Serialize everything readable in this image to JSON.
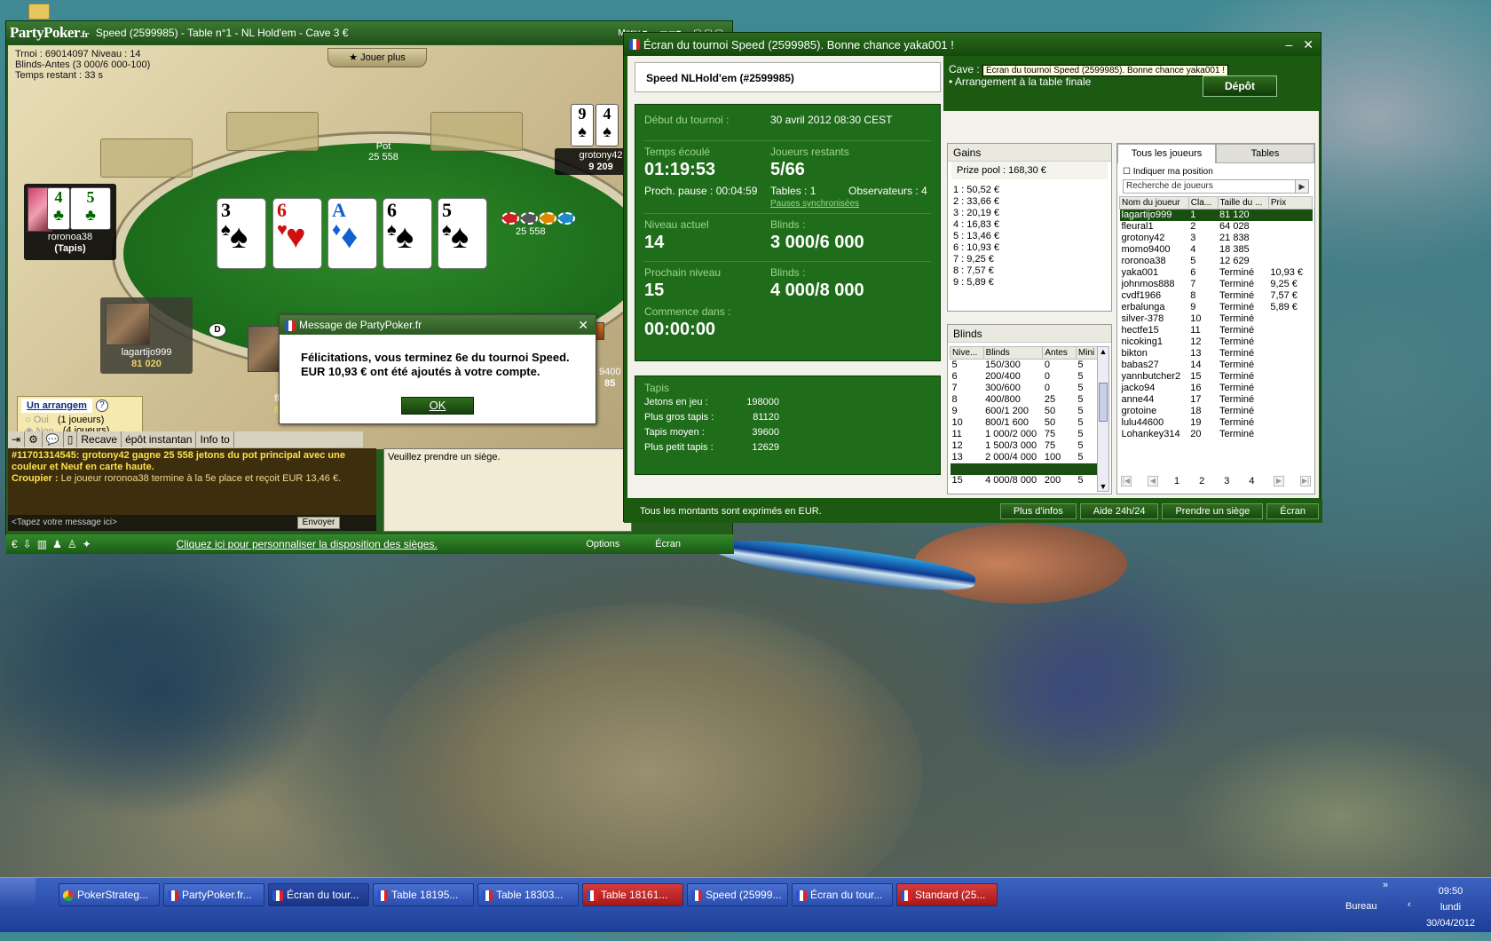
{
  "poker_window": {
    "title": "Speed (2599985) - Table n°1 -  NL Hold'em - Cave 3 €",
    "logo": "PartyPoker",
    "logo_suffix": ".fr",
    "menu_label": "Menu",
    "info_line1": "Trnoi : 69014097  Niveau : 14",
    "info_line2": "Blinds-Antes (3 000/6 000-100)",
    "info_line3": "Temps restant : 33 s",
    "jouer_plus": "Jouer plus",
    "pot_label": "Pot",
    "pot_value": "25 558",
    "side_pot": "25 558",
    "board_cards": [
      {
        "rank": "3",
        "suit": "♠",
        "color": "blk"
      },
      {
        "rank": "6",
        "suit": "♥",
        "color": "red"
      },
      {
        "rank": "A",
        "suit": "♦",
        "color": "blu"
      },
      {
        "rank": "6",
        "suit": "♠",
        "color": "blk"
      },
      {
        "rank": "5",
        "suit": "♠",
        "color": "blk"
      }
    ],
    "players": {
      "grotony42": {
        "name": "grotony42",
        "stack": "9 209",
        "cards": [
          {
            "rank": "9",
            "suit": "♠"
          },
          {
            "rank": "4",
            "suit": "♠"
          }
        ]
      },
      "roronoa38": {
        "name": "roronoa38",
        "stack": "(Tapis)",
        "cards": [
          {
            "rank": "4",
            "suit": "♣"
          },
          {
            "rank": "5",
            "suit": "♣"
          }
        ]
      },
      "lagartijo999": {
        "name": "lagartijo999",
        "stack": "81 020"
      },
      "partial_left": {
        "name": "fl",
        "stack": "6"
      },
      "partial_right": {
        "name": "9400",
        "stack": "85"
      }
    },
    "dealer_button": "D",
    "arrangement": {
      "title": "Un arrangem",
      "help": "?",
      "oui": "Oui",
      "oui_count": "(1 joueurs)",
      "non": "Non",
      "non_count": "(4 joueurs)"
    },
    "toolbar": [
      "Recave",
      "épôt instantan",
      "Info to"
    ],
    "chat": {
      "line1": "#11701314545: grotony42 gagne 25 558 jetons du pot principal avec une couleur et Neuf en carte haute.",
      "line2_label": "Croupier :",
      "line2": " Le joueur roronoa38 termine à la 5e place et reçoit EUR 13,46 €."
    },
    "chat_placeholder": "<Tapez votre message ici>",
    "send_label": "Envoyer",
    "seat_message": "Veuillez prendre un siège.",
    "bottom_link": "Cliquez ici pour personnaliser la disposition des sièges.",
    "options_label": "Options",
    "ecran_label": "Écran"
  },
  "message_dialog": {
    "title": "Message de PartyPoker.fr",
    "line1": "Félicitations, vous terminez 6e du tournoi Speed.",
    "line2": "EUR 10,93 € ont été ajoutés à votre compte.",
    "ok": "OK"
  },
  "tournament": {
    "title": "Écran du tournoi Speed (2599985). Bonne chance yaka001 !",
    "header": "Speed NLHold'em (#2599985)",
    "cave_label": "Cave :",
    "tooltip": "Écran du tournoi Speed (2599985). Bonne chance yaka001 !",
    "arrangement_note": "• Arrangement à la table finale",
    "depot": "Dépôt",
    "debut_label": "Début du tournoi :",
    "debut_value": "30 avril 2012  08:30 CEST",
    "temps_label": "Temps écoulé",
    "temps_value": "01:19:53",
    "joueurs_label": "Joueurs restants",
    "joueurs_value": "5/66",
    "pause_text": "Proch. pause : 00:04:59",
    "tables_text": "Tables : 1",
    "observateurs_text": "Observateurs :  4",
    "pauses_link": "Pauses synchronisées",
    "niveau_label": "Niveau actuel",
    "niveau_value": "14",
    "blinds_label": "Blinds :",
    "blinds_value": "3 000/6 000",
    "prochain_label": "Prochain niveau",
    "prochain_value": "15",
    "blinds2_label": "Blinds :",
    "blinds2_value": "4 000/8 000",
    "commence_label": "Commence dans :",
    "commence_value": "00:00:00",
    "tapis_title": "Tapis",
    "tapis": [
      {
        "label": "Jetons en jeu :",
        "value": "198000"
      },
      {
        "label": "Plus gros tapis :",
        "value": "81120"
      },
      {
        "label": "Tapis moyen :",
        "value": "39600"
      },
      {
        "label": "Plus petit tapis :",
        "value": "12629"
      }
    ],
    "gains_title": "Gains",
    "prize_pool": "Prize pool : 168,30 €",
    "gains": [
      "1 : 50,52 €",
      "2 : 33,66 €",
      "3 : 20,19 €",
      "4 : 16,83 €",
      "5 : 13,46 €",
      "6 : 10,93 €",
      "7 : 9,25 €",
      "8 : 7,57 €",
      "9 : 5,89 €"
    ],
    "blinds_title": "Blinds",
    "blinds_headers": [
      "Nive...",
      "Blinds",
      "Antes",
      "Mini"
    ],
    "blinds_rows": [
      [
        "5",
        "150/300",
        "0",
        "5"
      ],
      [
        "6",
        "200/400",
        "0",
        "5"
      ],
      [
        "7",
        "300/600",
        "0",
        "5"
      ],
      [
        "8",
        "400/800",
        "25",
        "5"
      ],
      [
        "9",
        "600/1 200",
        "50",
        "5"
      ],
      [
        "10",
        "800/1 600",
        "50",
        "5"
      ],
      [
        "11",
        "1 000/2 000",
        "75",
        "5"
      ],
      [
        "12",
        "1 500/3 000",
        "75",
        "5"
      ],
      [
        "13",
        "2 000/4 000",
        "100",
        "5"
      ],
      [
        "14",
        "3 000/6 000",
        "100",
        "5"
      ],
      [
        "15",
        "4 000/8 000",
        "200",
        "5"
      ]
    ],
    "tabs": [
      "Tous les joueurs",
      "Tables"
    ],
    "indiquer_label": "Indiquer ma position",
    "search_placeholder": "Recherche de joueurs",
    "players_headers": [
      "Nom du joueur",
      "Cla...",
      "Taille du ...",
      "Prix"
    ],
    "players_rows": [
      [
        "lagartijo999",
        "1",
        "81 120",
        ""
      ],
      [
        "fleural1",
        "2",
        "64 028",
        ""
      ],
      [
        "grotony42",
        "3",
        "21 838",
        ""
      ],
      [
        "momo9400",
        "4",
        "18 385",
        ""
      ],
      [
        "roronoa38",
        "5",
        "12 629",
        ""
      ],
      [
        "yaka001",
        "6",
        "Terminé",
        "10,93 €"
      ],
      [
        "johnmos888",
        "7",
        "Terminé",
        "9,25 €"
      ],
      [
        "cvdf1966",
        "8",
        "Terminé",
        "7,57 €"
      ],
      [
        "erbalunga",
        "9",
        "Terminé",
        "5,89 €"
      ],
      [
        "silver-378",
        "10",
        "Terminé",
        ""
      ],
      [
        "hectfe15",
        "11",
        "Terminé",
        ""
      ],
      [
        "nicoking1",
        "12",
        "Terminé",
        ""
      ],
      [
        "bikton",
        "13",
        "Terminé",
        ""
      ],
      [
        "babas27",
        "14",
        "Terminé",
        ""
      ],
      [
        "yannbutcher2",
        "15",
        "Terminé",
        ""
      ],
      [
        "jacko94",
        "16",
        "Terminé",
        ""
      ],
      [
        "anne44",
        "17",
        "Terminé",
        ""
      ],
      [
        "grotoine",
        "18",
        "Terminé",
        ""
      ],
      [
        "lulu44600",
        "19",
        "Terminé",
        ""
      ],
      [
        "Lohankey314",
        "20",
        "Terminé",
        ""
      ]
    ],
    "pages": [
      "1",
      "2",
      "3",
      "4"
    ],
    "footer_note": "Tous les montants sont exprimés en EUR.",
    "buttons": [
      "Plus d'infos",
      "Aide 24h/24",
      "Prendre un siège",
      "Écran"
    ]
  },
  "taskbar": {
    "items": [
      {
        "label": "PokerStrateg...",
        "icon": "chrome-icon",
        "style": "normal"
      },
      {
        "label": "PartyPoker.fr...",
        "icon": "partypoker-icon",
        "style": "normal"
      },
      {
        "label": "Écran du tour...",
        "icon": "partypoker-icon",
        "style": "dark"
      },
      {
        "label": "Table  18195...",
        "icon": "partypoker-icon",
        "style": "normal"
      },
      {
        "label": "Table  18303...",
        "icon": "partypoker-icon",
        "style": "normal"
      },
      {
        "label": "Table  18161...",
        "icon": "partypoker-icon",
        "style": "red"
      },
      {
        "label": "Speed (25999...",
        "icon": "partypoker-icon",
        "style": "normal"
      },
      {
        "label": "Écran du tour...",
        "icon": "partypoker-icon",
        "style": "normal"
      },
      {
        "label": "Standard (25...",
        "icon": "partypoker-icon",
        "style": "red"
      }
    ],
    "bureau": "Bureau",
    "time": "09:50",
    "day": "lundi",
    "date": "30/04/2012"
  }
}
